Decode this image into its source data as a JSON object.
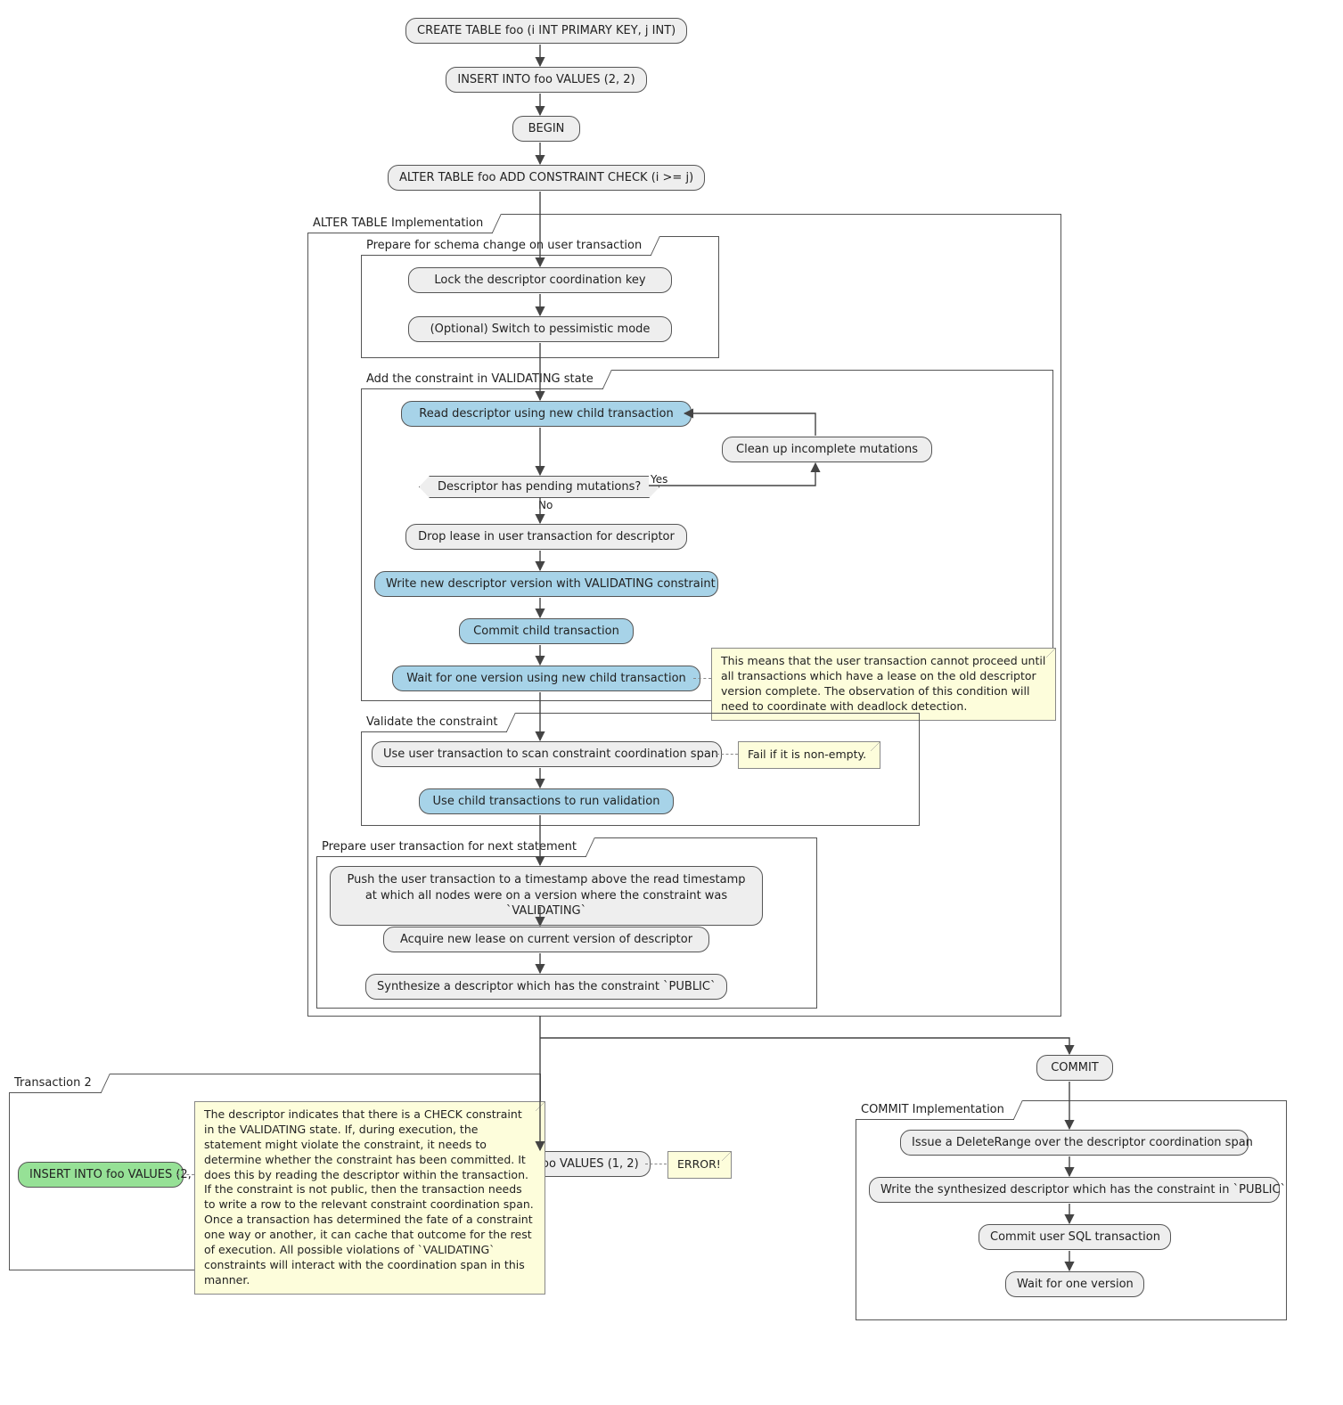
{
  "top": {
    "n1": "CREATE TABLE foo (i INT PRIMARY KEY, j INT)",
    "n2": "INSERT INTO foo VALUES (2, 2)",
    "n3": "BEGIN",
    "n4": "ALTER TABLE foo ADD CONSTRAINT CHECK (i >= j)"
  },
  "groups": {
    "alter": "ALTER TABLE Implementation",
    "prepare": "Prepare for schema change on user transaction",
    "add": "Add the constraint in VALIDATING state",
    "validate": "Validate the constraint",
    "next": "Prepare user transaction for next statement",
    "tx2": "Transaction 2",
    "commitimpl": "COMMIT Implementation"
  },
  "prepare": {
    "p1": "Lock the descriptor coordination key",
    "p2": "(Optional) Switch to pessimistic mode"
  },
  "add": {
    "a1": "Read descriptor using new child transaction",
    "a2": "Clean up incomplete mutations",
    "q": "Descriptor has pending mutations?",
    "yes": "Yes",
    "no": "No",
    "a3": "Drop lease in user transaction for descriptor",
    "a4": "Write new descriptor version with VALIDATING constraint",
    "a5": "Commit child transaction",
    "a6": "Wait for one version using new child transaction",
    "note": "This means that the user transaction cannot proceed until all transactions which have a lease on the old descriptor version complete. The observation of this condition will need to coordinate with deadlock detection."
  },
  "validate": {
    "v1": "Use user transaction to scan constraint coordination span",
    "vnote": "Fail if it is non-empty.",
    "v2": "Use child transactions to run validation"
  },
  "next": {
    "x1": "Push the user transaction to a timestamp above the read timestamp\nat which all nodes were on a version where the constraint was `VALIDATING`",
    "x2": "Acquire new lease on current version of descriptor",
    "x3": "Synthesize a descriptor which has the constraint `PUBLIC`"
  },
  "bottom": {
    "mid": "INSERT INTO foo VALUES (1, 2)",
    "miderr": "ERROR!",
    "commit": "COMMIT"
  },
  "commitimpl": {
    "c1": "Issue a DeleteRange over the descriptor coordination span",
    "c2": "Write the synthesized descriptor which has the constraint in `PUBLIC`",
    "c3": "Commit user SQL transaction",
    "c4": "Wait for one version"
  },
  "tx2": {
    "t1": "INSERT INTO foo VALUES (2, 3)",
    "tnote": "The descriptor indicates that there is a CHECK constraint in the VALIDATING state. If, during execution, the statement might violate the constraint, it needs to determine whether the constraint has been committed. It does this by reading the descriptor within the transaction. If the constraint is not public, then the transaction needs to write a row to the relevant constraint coordination span. Once a transaction has determined the fate of a constraint one way or another, it can cache that outcome for the rest of execution. All possible violations of `VALIDATING` constraints will interact with the coordination span in this manner."
  }
}
